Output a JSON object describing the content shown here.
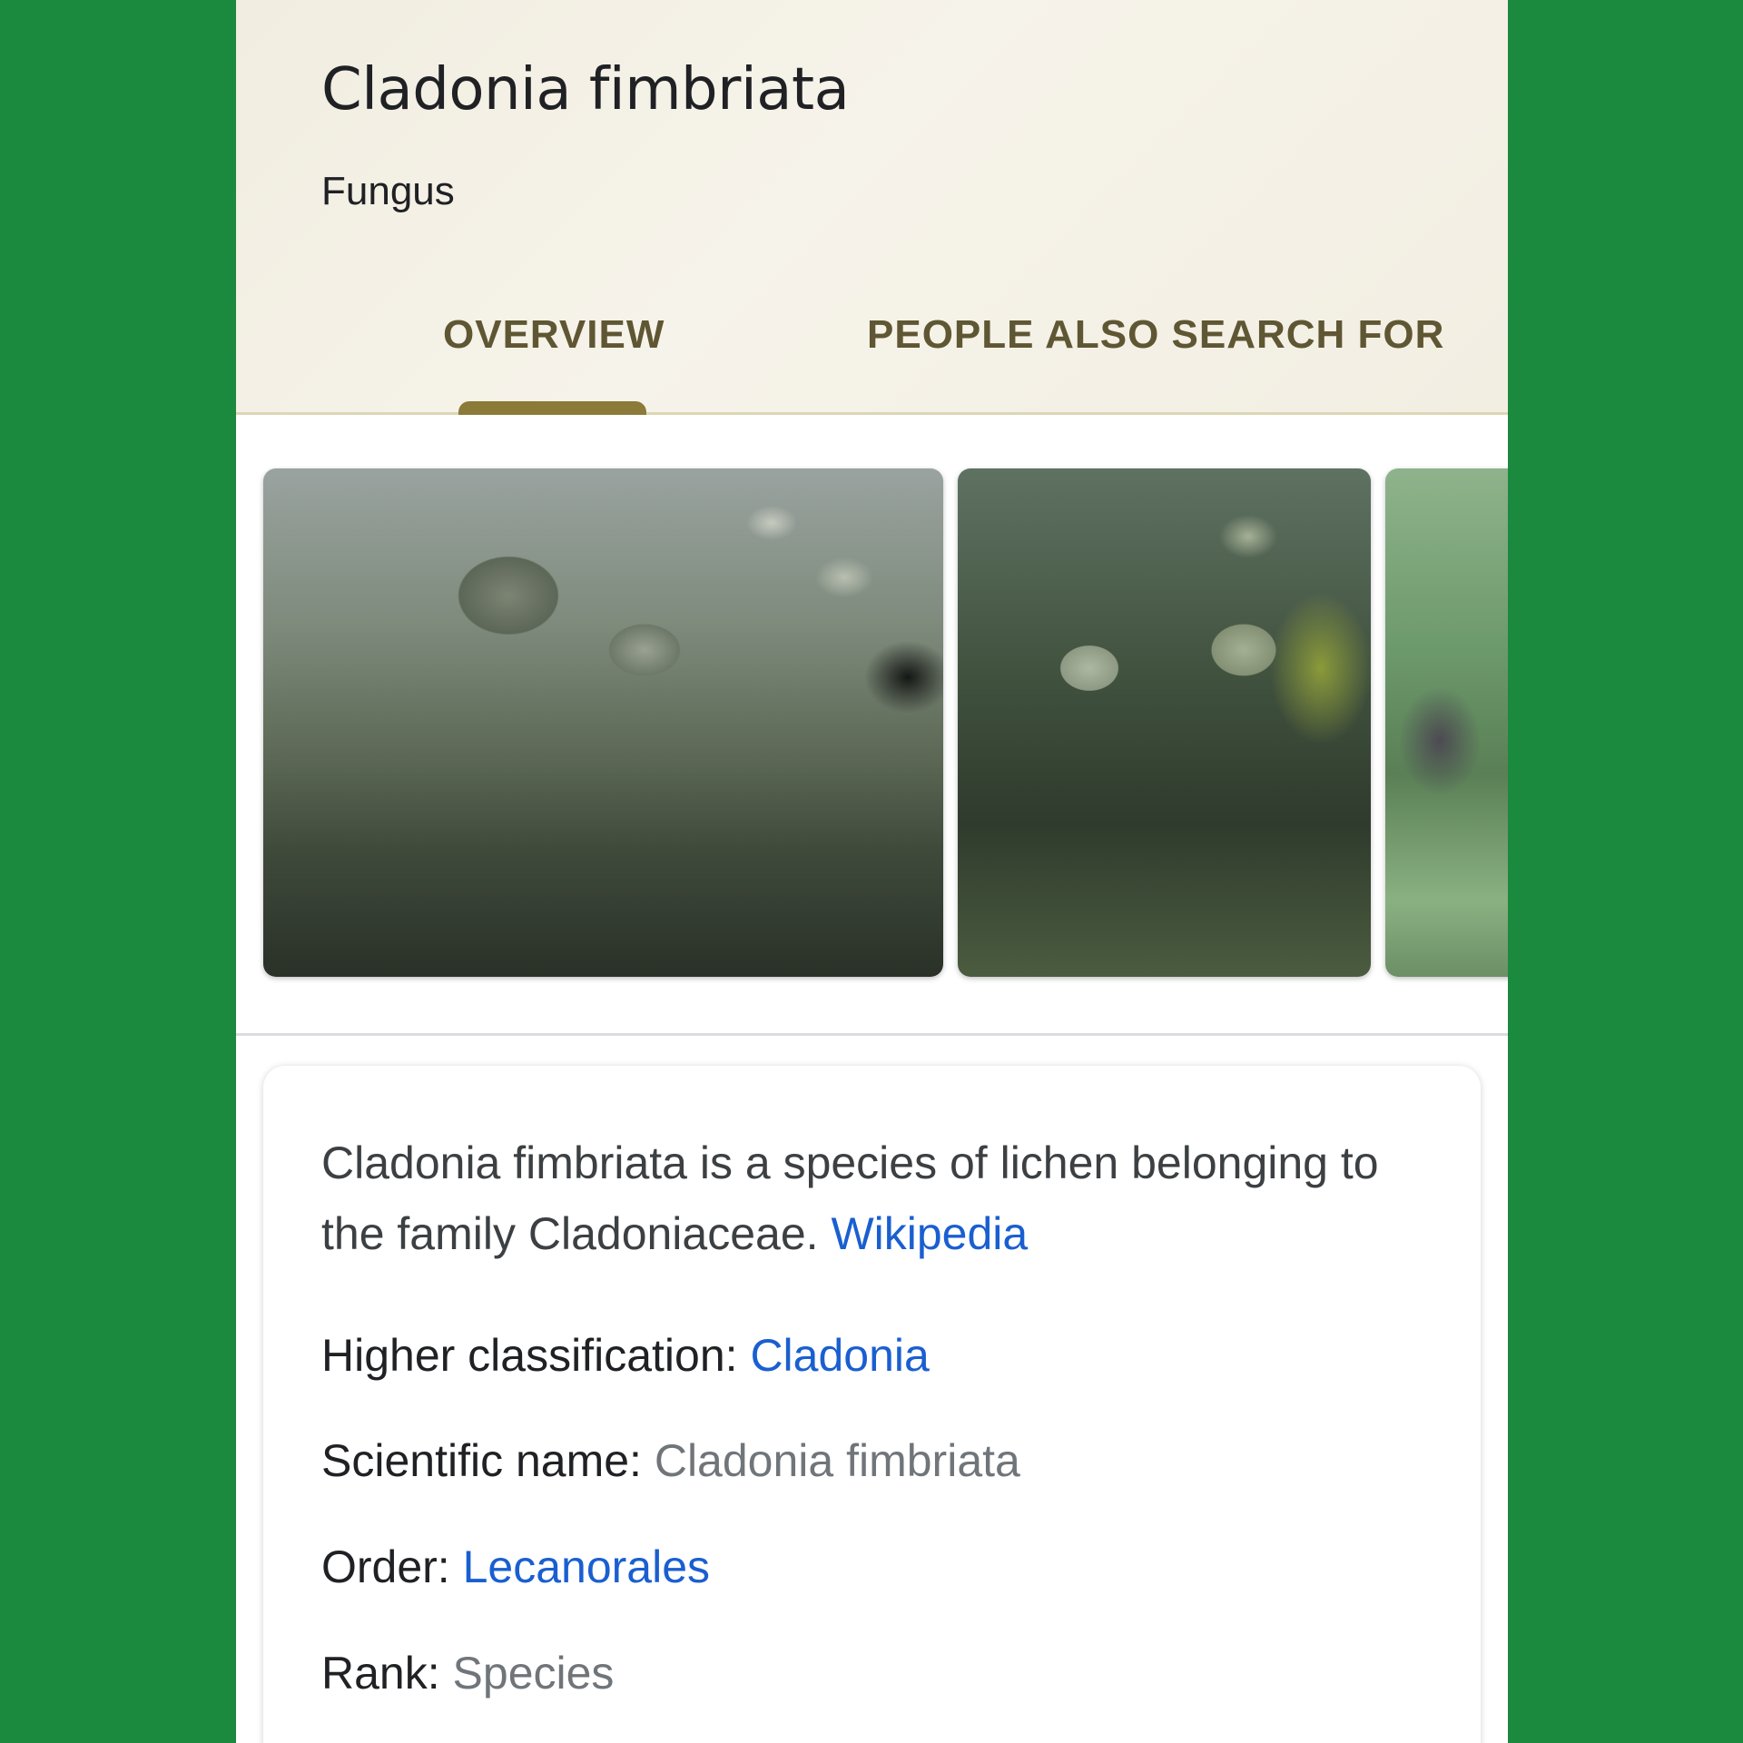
{
  "header": {
    "title": "Cladonia fimbriata",
    "subtitle": "Fungus",
    "more_icon": "more-vert-icon"
  },
  "tabs": [
    {
      "label": "OVERVIEW",
      "selected": true
    },
    {
      "label": "PEOPLE ALSO SEARCH FOR",
      "selected": false
    }
  ],
  "images": [
    {
      "alt": "Cladonia fimbriata photo 1"
    },
    {
      "alt": "Cladonia fimbriata photo 2"
    },
    {
      "alt": "Cladonia fimbriata photo 3"
    }
  ],
  "description": {
    "text": "Cladonia fimbriata is a species of lichen belonging to the family Cladoniaceae.",
    "source_link": "Wikipedia"
  },
  "facts": [
    {
      "label": "Higher classification:",
      "value": "Cladonia",
      "is_link": true
    },
    {
      "label": "Scientific name:",
      "value": "Cladonia fimbriata",
      "is_link": false
    },
    {
      "label": "Order:",
      "value": "Lecanorales",
      "is_link": true
    },
    {
      "label": "Rank:",
      "value": "Species",
      "is_link": false
    }
  ],
  "colors": {
    "background": "#1b893e",
    "header_bg": "#f4f1e7",
    "tab_text": "#5f5633",
    "tab_indicator": "#8b7a38",
    "link": "#1a5fd0",
    "gray_value": "#70757a"
  }
}
